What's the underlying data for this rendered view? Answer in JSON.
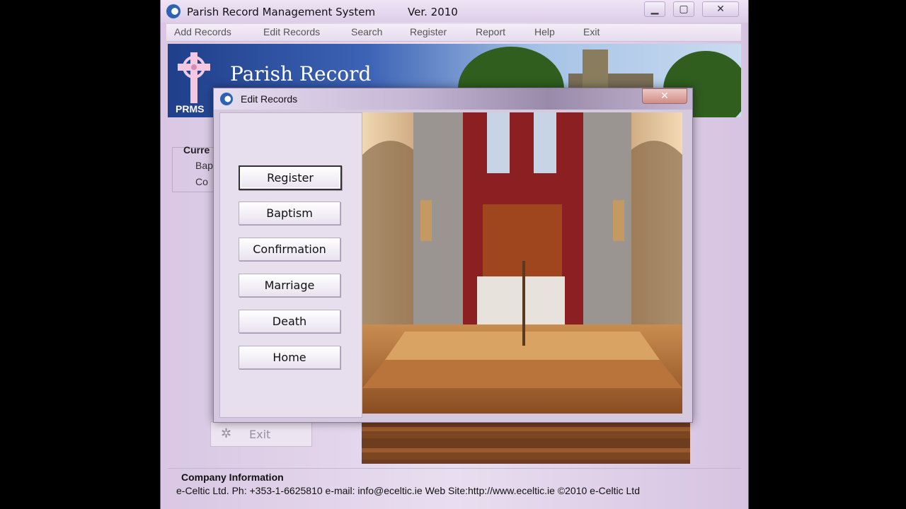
{
  "window": {
    "title": "Parish Record Management System",
    "version": "Ver. 2010",
    "controls": {
      "minimize": "▁",
      "maximize": "▢",
      "close": "✕"
    }
  },
  "menu": {
    "items": [
      "Add Records",
      "Edit Records",
      "Search",
      "Register",
      "Report",
      "Help",
      "Exit"
    ]
  },
  "banner": {
    "title": "Parish Record",
    "logo_text": "PRMS"
  },
  "background": {
    "current_label": "Curre",
    "current_items": [
      "Bap",
      "Co"
    ],
    "exit_label": "Exit"
  },
  "company": {
    "title": "Company Information",
    "line": "e-Celtic Ltd.  Ph: +353-1-6625810  e-mail: info@eceltic.ie  Web Site:http://www.eceltic.ie  ©2010 e-Celtic Ltd"
  },
  "dialog": {
    "title": "Edit Records",
    "close": "✕",
    "buttons": [
      "Register",
      "Baptism",
      "Confirmation",
      "Marriage",
      "Death",
      "Home"
    ],
    "active_button": "Register"
  },
  "colors": {
    "window_bg": "#e3d6eb",
    "banner_blue": "#2b4f9e",
    "menu_text": "#555555",
    "dialog_close": "#d08d86"
  }
}
